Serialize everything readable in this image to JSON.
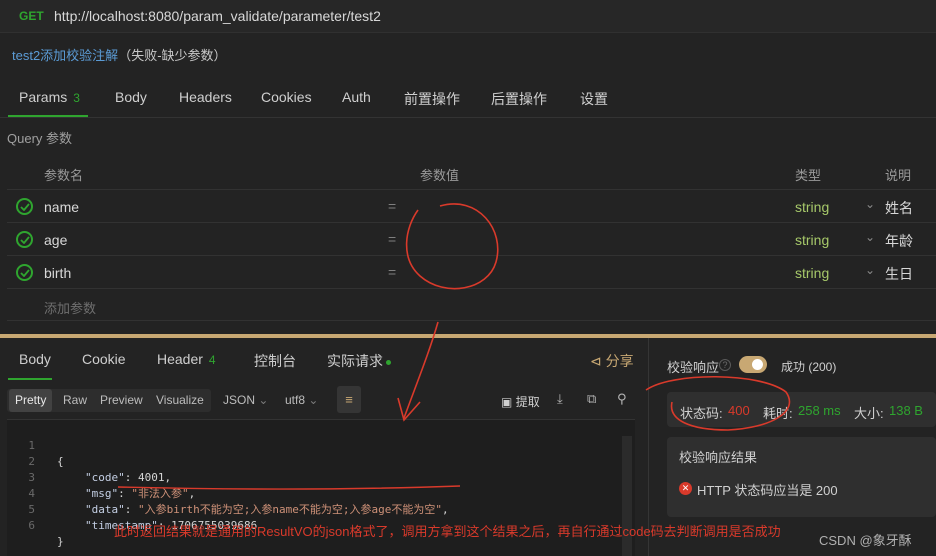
{
  "request": {
    "method": "GET",
    "url": "http://localhost:8080/param_validate/parameter/test2",
    "description_name": "test2添加校验注解",
    "description_suffix": "（失败-缺少参数）"
  },
  "request_tabs": [
    {
      "label": "Params",
      "count": "3",
      "active": true
    },
    {
      "label": "Body"
    },
    {
      "label": "Headers"
    },
    {
      "label": "Cookies"
    },
    {
      "label": "Auth"
    },
    {
      "label": "前置操作"
    },
    {
      "label": "后置操作"
    },
    {
      "label": "设置"
    }
  ],
  "params": {
    "section_label": "Query 参数",
    "headers": {
      "name": "参数名",
      "value": "参数值",
      "type": "类型",
      "desc": "说明"
    },
    "rows": [
      {
        "name": "name",
        "eq": "=",
        "type": "string",
        "desc": "姓名"
      },
      {
        "name": "age",
        "eq": "=",
        "type": "string",
        "desc": "年龄"
      },
      {
        "name": "birth",
        "eq": "=",
        "type": "string",
        "desc": "生日"
      }
    ],
    "add_placeholder": "添加参数"
  },
  "response_tabs": [
    {
      "label": "Body",
      "active": true
    },
    {
      "label": "Cookie"
    },
    {
      "label": "Header",
      "count": "4"
    },
    {
      "label": "控制台"
    },
    {
      "label": "实际请求"
    }
  ],
  "share_label": "分享",
  "view_modes": [
    "Pretty",
    "Raw",
    "Preview",
    "Visualize"
  ],
  "format_value": "JSON",
  "encoding_value": "utf8",
  "extract_label": "提取",
  "code_lines": [
    {
      "n": "1"
    },
    {
      "n": "2"
    },
    {
      "n": "3"
    },
    {
      "n": "4"
    },
    {
      "n": "5"
    },
    {
      "n": "6"
    }
  ],
  "code": {
    "open": "{",
    "close": "}",
    "code_key": "\"code\"",
    "code_val": "4001",
    "msg_key": "\"msg\"",
    "msg_val": "\"非法入参\"",
    "data_key": "\"data\"",
    "data_val": "\"入参birth不能为空;入参name不能为空;入参age不能为空\"",
    "ts_key": "\"timestamp\"",
    "ts_val": "1706755039686"
  },
  "verify": {
    "label": "校验响应",
    "help": "?",
    "success_label": "成功 (200)"
  },
  "status": {
    "code_label": "状态码:",
    "code_value": "400",
    "time_label": "耗时:",
    "time_value": "258 ms",
    "size_label": "大小:",
    "size_value": "138 B"
  },
  "result": {
    "title": "校验响应结果",
    "message": "HTTP 状态码应当是 200"
  },
  "annotation": "此时返回结果就是通用的ResultVO的json格式了，调用方拿到这个结果之后，再自行通过code码去判断调用是否成功",
  "watermark": "CSDN @象牙酥",
  "colors": {
    "accent": "#2fa52f",
    "warning": "#c8a873",
    "error": "#d93a2b"
  }
}
